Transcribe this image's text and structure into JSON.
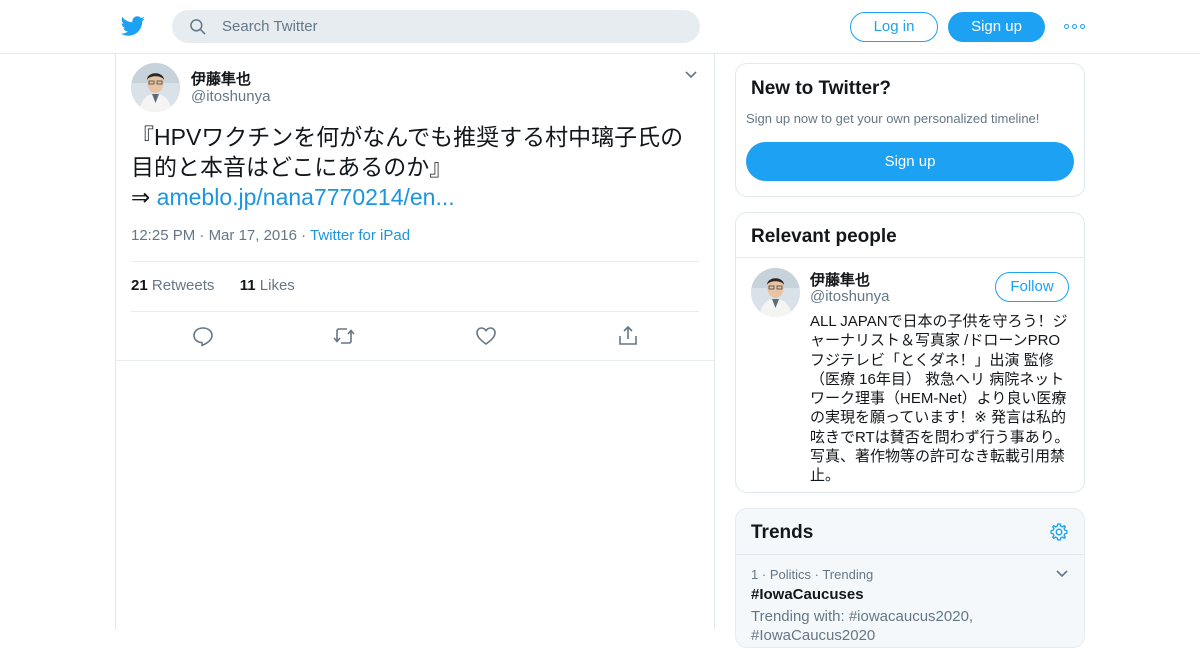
{
  "header": {
    "logo_icon": "twitter-bird-icon",
    "search_placeholder": "Search Twitter",
    "login_label": "Log in",
    "signup_label": "Sign up",
    "more_icon": "more-dots-icon"
  },
  "tweet": {
    "author_name": "伊藤隼也",
    "author_handle": "@itoshunya",
    "text": "『HPVワクチンを何がなんでも推奨する村中璃子氏の目的と本音はどこにあるのか』",
    "arrow": "⇒",
    "link": "ameblo.jp/nana7770214/en...",
    "time": "12:25 PM",
    "date": "Mar 17, 2016",
    "source": "Twitter for iPad",
    "retweets_count": "21",
    "retweets_label": "Retweets",
    "likes_count": "11",
    "likes_label": "Likes"
  },
  "new_to_twitter": {
    "title": "New to Twitter?",
    "subtitle": "Sign up now to get your own personalized timeline!",
    "button": "Sign up"
  },
  "relevant_people": {
    "title": "Relevant people",
    "name": "伊藤隼也",
    "handle": "@itoshunya",
    "follow_label": "Follow",
    "bio": "ALL JAPANで日本の子供を守ろう！ジャーナリスト＆写真家 /ドローンPRO フジテレビ「とくダネ！」出演 監修（医療 16年目） 救急ヘリ 病院ネットワーク理事（HEM-Net）より良い医療の実現を願っています！※ 発言は私的呟きでRTは賛否を問わず行う事あり。写真、著作物等の許可なき転載引用禁止。"
  },
  "trends": {
    "title": "Trends",
    "items": [
      {
        "rank": "1",
        "category": "Politics",
        "status": "Trending",
        "name": "#IowaCaucuses",
        "with": "Trending with: #iowacaucus2020, #IowaCaucus2020"
      }
    ]
  },
  "colors": {
    "accent": "#1da1f2",
    "link": "#1b95e0",
    "text": "#14171a",
    "secondary": "#657786",
    "border": "#e1e8ed"
  }
}
